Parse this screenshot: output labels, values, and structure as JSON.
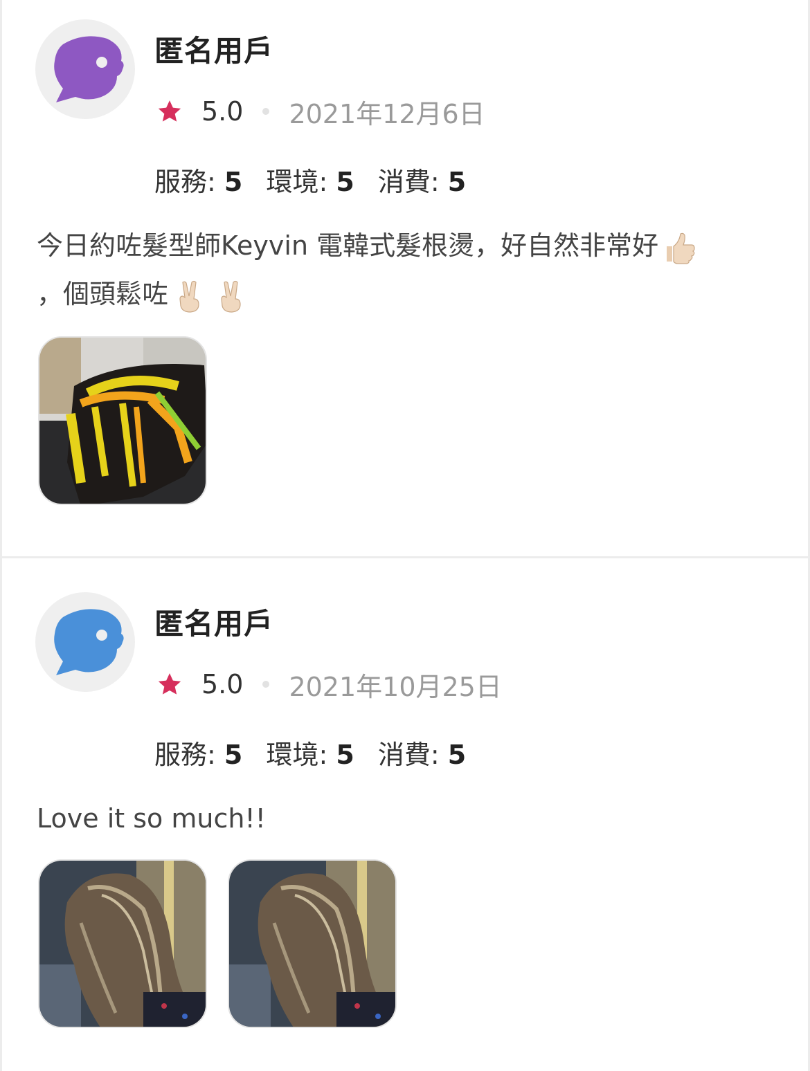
{
  "reviews": [
    {
      "username": "匿名用戶",
      "avatar_color": "#8e58c2",
      "avatar_icon": "chat-bubble-face-icon",
      "rating": "5.0",
      "date": "2021年12月6日",
      "scores": [
        {
          "label": "服務: ",
          "value": "5"
        },
        {
          "label": "環境: ",
          "value": "5"
        },
        {
          "label": "消費: ",
          "value": "5"
        }
      ],
      "text_part1": "今日約咗髮型師Keyvin 電韓式髮根燙，好自然非常好",
      "text_part2": "，個頭鬆咗",
      "emojis": [
        "thumbs-up-icon",
        "victory-hand-icon",
        "victory-hand-icon"
      ],
      "photos": [
        "hair-perm-rollers-photo"
      ]
    },
    {
      "username": "匿名用戶",
      "avatar_color": "#4a90d9",
      "avatar_icon": "chat-bubble-face-icon",
      "rating": "5.0",
      "date": "2021年10月25日",
      "scores": [
        {
          "label": "服務: ",
          "value": "5"
        },
        {
          "label": "環境: ",
          "value": "5"
        },
        {
          "label": "消費: ",
          "value": "5"
        }
      ],
      "text_part1": "Love it so much!!",
      "photos": [
        "hair-highlights-photo",
        "hair-highlights-photo"
      ]
    }
  ],
  "colors": {
    "star": "#d62f5c",
    "date": "#9a9a9a",
    "text": "#444444",
    "divider": "#ececec"
  }
}
